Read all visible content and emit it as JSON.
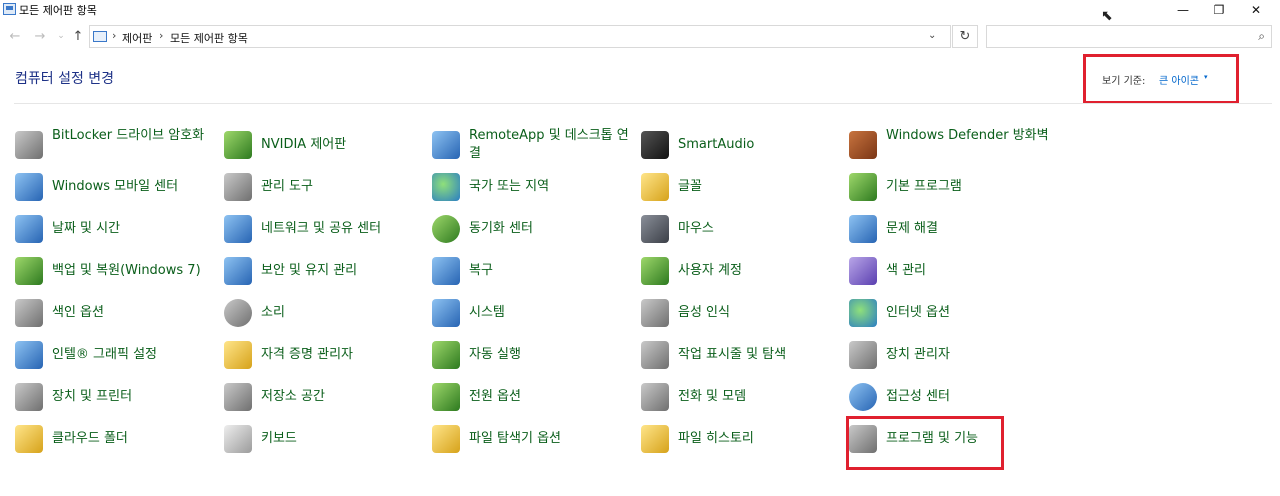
{
  "window": {
    "title": "모든 제어판 항목",
    "controls": {
      "minimize": "—",
      "maximize": "❐",
      "close": "✕"
    }
  },
  "address": {
    "breadcrumbs": [
      "제어판",
      "모든 제어판 항목"
    ],
    "separator": "›",
    "dropdown": "⌄",
    "refresh": "↻",
    "search_placeholder": "",
    "search_icon": "⌕"
  },
  "nav": {
    "back": "←",
    "forward": "→",
    "history": "⌄",
    "up": "↑"
  },
  "header": {
    "title": "컴퓨터 설정 변경",
    "view_by_label": "보기 기준:",
    "view_by_value": "큰 아이콘",
    "view_by_caret": "▾"
  },
  "items": [
    {
      "label": "BitLocker 드라이브 암호화",
      "icon": "bitlocker-icon"
    },
    {
      "label": "NVIDIA 제어판",
      "icon": "nvidia-icon"
    },
    {
      "label": "RemoteApp 및 데스크톱 연결",
      "icon": "remoteapp-icon"
    },
    {
      "label": "SmartAudio",
      "icon": "smartaudio-icon"
    },
    {
      "label": "Windows Defender 방화벽",
      "icon": "firewall-icon"
    },
    {
      "label": "Windows 모바일 센터",
      "icon": "mobility-center-icon"
    },
    {
      "label": "관리 도구",
      "icon": "admin-tools-icon"
    },
    {
      "label": "국가 또는 지역",
      "icon": "region-icon"
    },
    {
      "label": "글꼴",
      "icon": "fonts-icon"
    },
    {
      "label": "기본 프로그램",
      "icon": "default-programs-icon"
    },
    {
      "label": "날짜 및 시간",
      "icon": "date-time-icon"
    },
    {
      "label": "네트워크 및 공유 센터",
      "icon": "network-icon"
    },
    {
      "label": "동기화 센터",
      "icon": "sync-center-icon"
    },
    {
      "label": "마우스",
      "icon": "mouse-icon"
    },
    {
      "label": "문제 해결",
      "icon": "troubleshooting-icon"
    },
    {
      "label": "백업 및 복원(Windows 7)",
      "icon": "backup-icon"
    },
    {
      "label": "보안 및 유지 관리",
      "icon": "security-flag-icon"
    },
    {
      "label": "복구",
      "icon": "recovery-icon"
    },
    {
      "label": "사용자 계정",
      "icon": "user-accounts-icon"
    },
    {
      "label": "색 관리",
      "icon": "color-management-icon"
    },
    {
      "label": "색인 옵션",
      "icon": "indexing-icon"
    },
    {
      "label": "소리",
      "icon": "sound-icon"
    },
    {
      "label": "시스템",
      "icon": "system-icon"
    },
    {
      "label": "음성 인식",
      "icon": "microphone-icon"
    },
    {
      "label": "인터넷 옵션",
      "icon": "internet-options-icon"
    },
    {
      "label": "인텔® 그래픽 설정",
      "icon": "intel-graphics-icon"
    },
    {
      "label": "자격 증명 관리자",
      "icon": "credential-icon"
    },
    {
      "label": "자동 실행",
      "icon": "autoplay-icon"
    },
    {
      "label": "작업 표시줄 및 탐색",
      "icon": "taskbar-icon"
    },
    {
      "label": "장치 관리자",
      "icon": "device-manager-icon"
    },
    {
      "label": "장치 및 프린터",
      "icon": "printer-icon"
    },
    {
      "label": "저장소 공간",
      "icon": "storage-spaces-icon"
    },
    {
      "label": "전원 옵션",
      "icon": "power-icon"
    },
    {
      "label": "전화 및 모뎀",
      "icon": "phone-modem-icon"
    },
    {
      "label": "접근성 센터",
      "icon": "ease-of-access-icon"
    },
    {
      "label": "클라우드 폴더",
      "icon": "cloud-folder-icon"
    },
    {
      "label": "키보드",
      "icon": "keyboard-icon"
    },
    {
      "label": "파일 탐색기 옵션",
      "icon": "folder-options-icon"
    },
    {
      "label": "파일 히스토리",
      "icon": "file-history-icon"
    },
    {
      "label": "프로그램 및 기능",
      "icon": "programs-features-icon"
    }
  ]
}
